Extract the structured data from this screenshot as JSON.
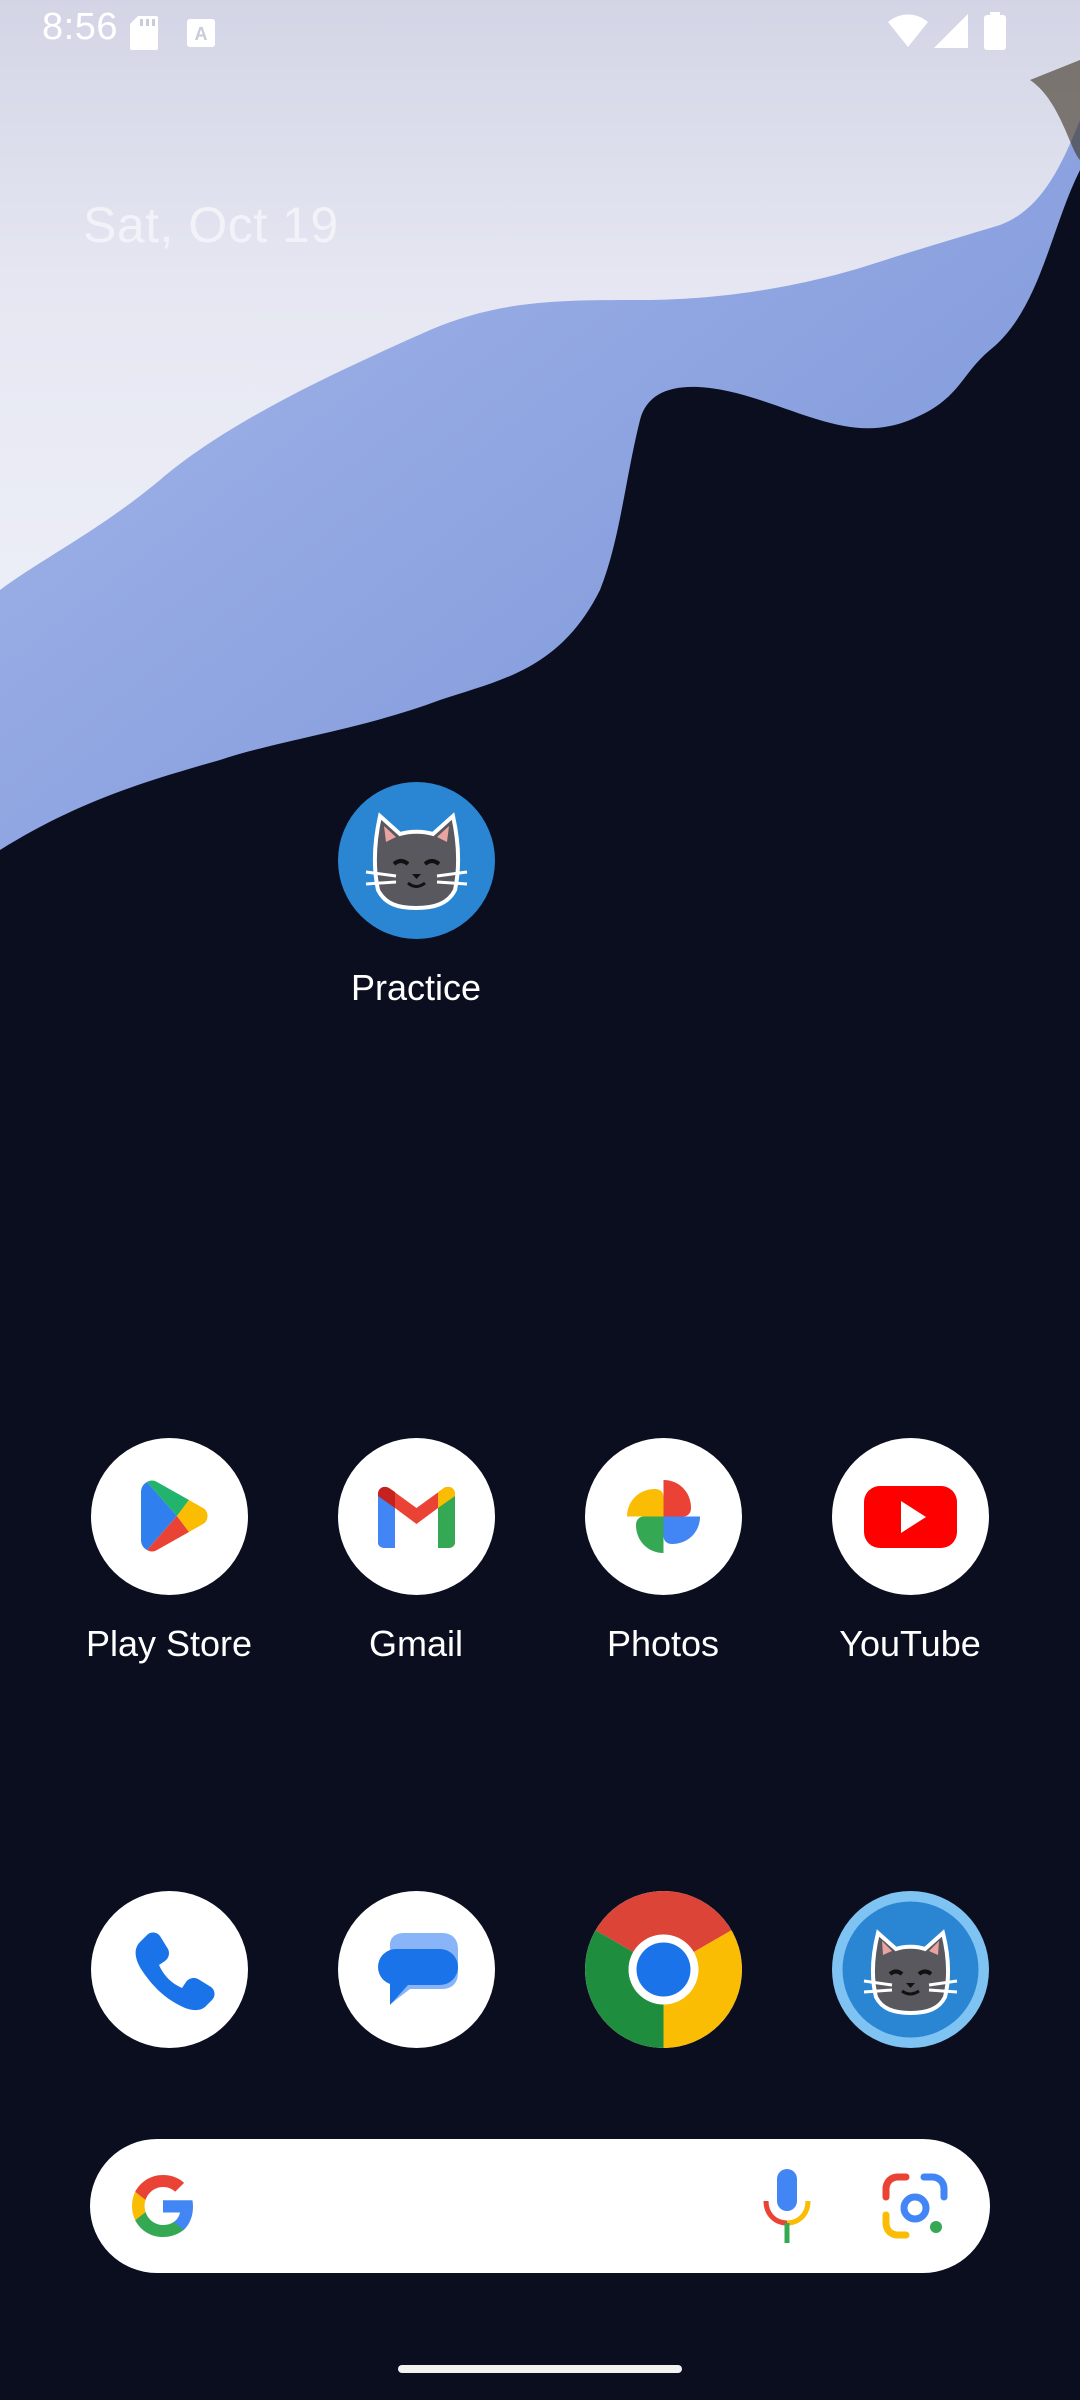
{
  "status_bar": {
    "time": "8:56",
    "icons": [
      "sd-card-icon",
      "keyboard-a-icon",
      "wifi-icon",
      "cell-signal-icon",
      "battery-icon"
    ]
  },
  "home": {
    "date": "Sat, Oct 19",
    "apps": [
      {
        "label": "Practice",
        "icon": "cat-icon"
      },
      {
        "label": "Play Store",
        "icon": "play-store-icon"
      },
      {
        "label": "Gmail",
        "icon": "gmail-icon"
      },
      {
        "label": "Photos",
        "icon": "photos-icon"
      },
      {
        "label": "YouTube",
        "icon": "youtube-icon"
      }
    ],
    "dock": [
      {
        "icon": "phone-icon"
      },
      {
        "icon": "messages-icon"
      },
      {
        "icon": "chrome-icon"
      },
      {
        "icon": "cat-icon"
      }
    ]
  },
  "search_bar": {
    "icons": [
      "google-g-icon",
      "microphone-icon",
      "google-lens-icon"
    ]
  },
  "colors": {
    "wallpaper_dark": "#0b0e1f",
    "wallpaper_blue": "#8ea3e0",
    "practice_icon_bg": "#2a86d3",
    "dock_cat_bg": "#7fc3f3"
  }
}
